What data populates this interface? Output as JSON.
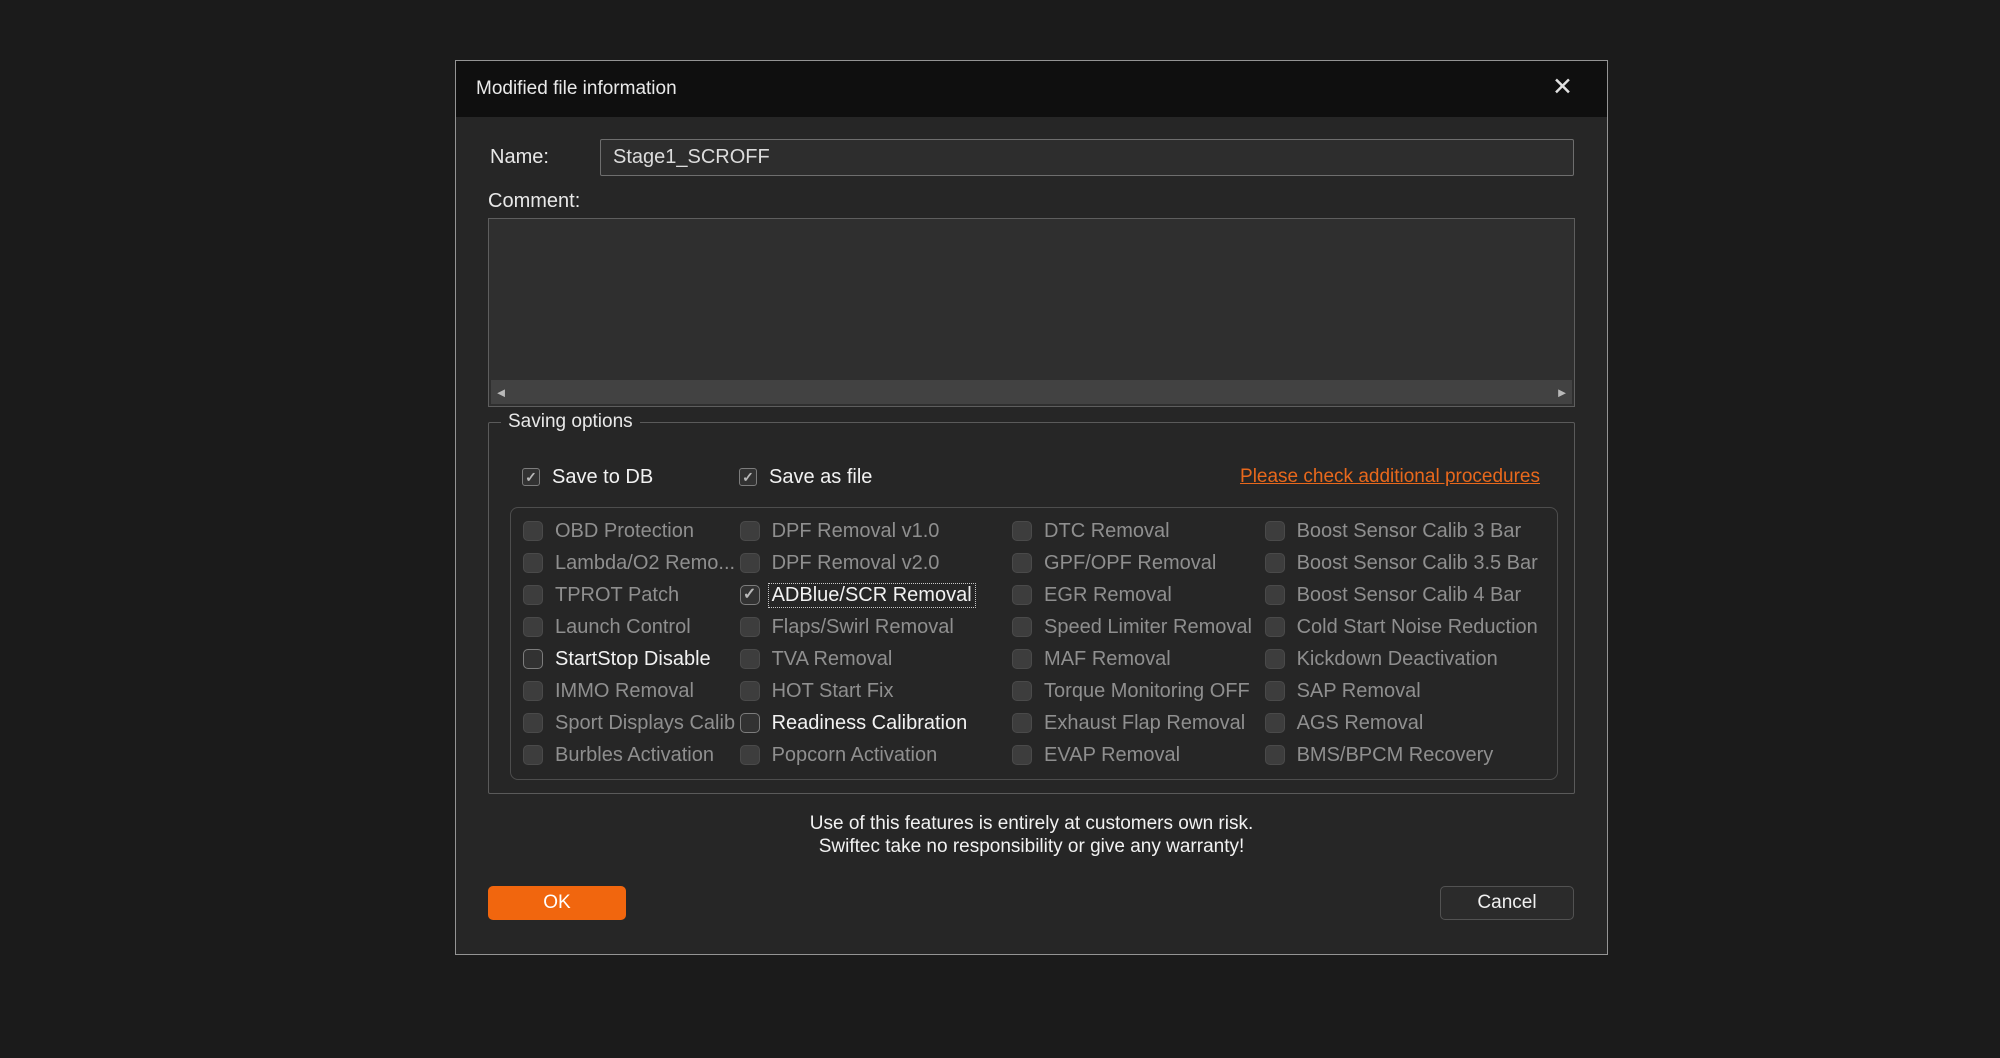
{
  "dialog": {
    "title": "Modified file information",
    "close_icon": "✕"
  },
  "fields": {
    "name_label": "Name:",
    "name_value": "Stage1_SCROFF",
    "comment_label": "Comment:",
    "comment_value": ""
  },
  "scrollbar": {
    "left_arrow": "◄",
    "right_arrow": "►"
  },
  "saving_options": {
    "group_label": "Saving options",
    "save_to_db": {
      "label": "Save to DB",
      "state": "enabled checked"
    },
    "save_as_file": {
      "label": "Save as file",
      "state": "enabled checked"
    },
    "link_text": "Please check additional procedures",
    "grid": {
      "columns": [
        {
          "items": [
            {
              "label": "OBD Protection",
              "state": "disabled"
            },
            {
              "label": "Lambda/O2 Remo...",
              "state": "disabled"
            },
            {
              "label": "TPROT Patch",
              "state": "disabled"
            },
            {
              "label": "Launch Control",
              "state": "disabled"
            },
            {
              "label": "StartStop Disable",
              "state": "enabled"
            },
            {
              "label": "IMMO Removal",
              "state": "disabled"
            },
            {
              "label": "Sport Displays Calib",
              "state": "disabled"
            },
            {
              "label": "Burbles Activation",
              "state": "disabled"
            }
          ]
        },
        {
          "items": [
            {
              "label": "DPF Removal v1.0",
              "state": "disabled"
            },
            {
              "label": "DPF Removal v2.0",
              "state": "disabled"
            },
            {
              "label": "ADBlue/SCR Removal",
              "state": "enabled checked focused"
            },
            {
              "label": "Flaps/Swirl Removal",
              "state": "disabled"
            },
            {
              "label": "TVA Removal",
              "state": "disabled"
            },
            {
              "label": "HOT Start Fix",
              "state": "disabled"
            },
            {
              "label": "Readiness Calibration",
              "state": "enabled"
            },
            {
              "label": "Popcorn Activation",
              "state": "disabled"
            }
          ]
        },
        {
          "items": [
            {
              "label": "DTC Removal",
              "state": "disabled"
            },
            {
              "label": "GPF/OPF Removal",
              "state": "disabled"
            },
            {
              "label": "EGR Removal",
              "state": "disabled"
            },
            {
              "label": "Speed Limiter Removal",
              "state": "disabled"
            },
            {
              "label": "MAF Removal",
              "state": "disabled"
            },
            {
              "label": "Torque Monitoring OFF",
              "state": "disabled"
            },
            {
              "label": "Exhaust Flap Removal",
              "state": "disabled"
            },
            {
              "label": "EVAP Removal",
              "state": "disabled"
            }
          ]
        },
        {
          "items": [
            {
              "label": "Boost Sensor Calib 3 Bar",
              "state": "disabled"
            },
            {
              "label": "Boost Sensor Calib 3.5 Bar",
              "state": "disabled"
            },
            {
              "label": "Boost Sensor Calib 4 Bar",
              "state": "disabled"
            },
            {
              "label": "Cold Start Noise Reduction",
              "state": "disabled"
            },
            {
              "label": "Kickdown Deactivation",
              "state": "disabled"
            },
            {
              "label": "SAP Removal",
              "state": "disabled"
            },
            {
              "label": "AGS Removal",
              "state": "disabled"
            },
            {
              "label": "BMS/BPCM Recovery",
              "state": "disabled"
            }
          ]
        }
      ]
    }
  },
  "footer": {
    "warning_line1": "Use of this features is entirely at customers own risk.",
    "warning_line2": "Swiftec take no responsibility or give any warranty!",
    "ok_label": "OK",
    "cancel_label": "Cancel"
  },
  "colors": {
    "accent_orange": "#f1660e",
    "link_orange": "#e8681c",
    "dialog_bg": "#262626",
    "titlebar_bg": "#0f0f0f",
    "page_bg": "#1b1b1b"
  }
}
